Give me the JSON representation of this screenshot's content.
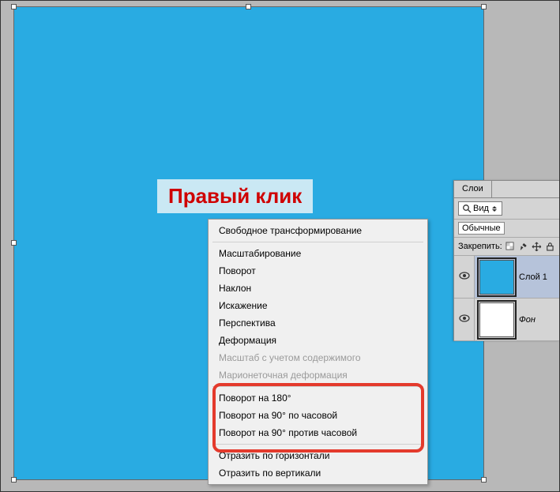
{
  "annotation": {
    "label": "Правый клик"
  },
  "context_menu": {
    "items": [
      {
        "label": "Свободное трансформирование",
        "disabled": false,
        "sep_after": true
      },
      {
        "label": "Масштабирование",
        "disabled": false
      },
      {
        "label": "Поворот",
        "disabled": false
      },
      {
        "label": "Наклон",
        "disabled": false
      },
      {
        "label": "Искажение",
        "disabled": false
      },
      {
        "label": "Перспектива",
        "disabled": false
      },
      {
        "label": "Деформация",
        "disabled": false
      },
      {
        "label": "Масштаб с учетом содержимого",
        "disabled": true
      },
      {
        "label": "Марионеточная деформация",
        "disabled": true,
        "sep_after": true
      },
      {
        "label": "Поворот на 180°",
        "disabled": false
      },
      {
        "label": "Поворот на 90° по часовой",
        "disabled": false
      },
      {
        "label": "Поворот на 90° против часовой",
        "disabled": false,
        "sep_after": true
      },
      {
        "label": "Отразить по горизонтали",
        "disabled": false
      },
      {
        "label": "Отразить по вертикали",
        "disabled": false
      }
    ]
  },
  "layers_panel": {
    "tab": "Слои",
    "view_dropdown": "Вид",
    "blend_mode": "Обычные",
    "lock_label": "Закрепить:",
    "layers": [
      {
        "name": "Слой 1",
        "thumb_color": "#29abe2",
        "visible": true,
        "active": true,
        "italic": false
      },
      {
        "name": "Фон",
        "thumb_color": "#ffffff",
        "visible": true,
        "active": false,
        "italic": true
      }
    ]
  },
  "colors": {
    "canvas_fill": "#29abe2",
    "workspace_bg": "#b8b8b8",
    "highlight": "#e43a2c"
  }
}
